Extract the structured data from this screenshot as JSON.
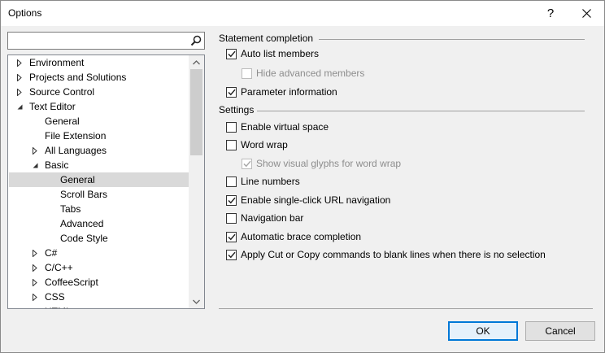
{
  "window": {
    "title": "Options",
    "help_glyph": "?",
    "close_glyph": "✕"
  },
  "search": {
    "value": "",
    "placeholder": ""
  },
  "tree": {
    "items": [
      {
        "label": "Environment",
        "expander": "collapsed"
      },
      {
        "label": "Projects and Solutions",
        "expander": "collapsed"
      },
      {
        "label": "Source Control",
        "expander": "collapsed"
      },
      {
        "label": "Text Editor",
        "expander": "expanded"
      },
      {
        "label": "General",
        "expander": "none"
      },
      {
        "label": "File Extension",
        "expander": "none"
      },
      {
        "label": "All Languages",
        "expander": "collapsed"
      },
      {
        "label": "Basic",
        "expander": "expanded"
      },
      {
        "label": "General",
        "expander": "none",
        "selected": true
      },
      {
        "label": "Scroll Bars",
        "expander": "none"
      },
      {
        "label": "Tabs",
        "expander": "none"
      },
      {
        "label": "Advanced",
        "expander": "none"
      },
      {
        "label": "Code Style",
        "expander": "none"
      },
      {
        "label": "C#",
        "expander": "collapsed"
      },
      {
        "label": "C/C++",
        "expander": "collapsed"
      },
      {
        "label": "CoffeeScript",
        "expander": "collapsed"
      },
      {
        "label": "CSS",
        "expander": "collapsed"
      },
      {
        "label": "HTML",
        "expander": "collapsed"
      }
    ]
  },
  "groups": {
    "statement_completion": {
      "header": "Statement completion",
      "options": [
        {
          "label": "Auto list members",
          "checked": true,
          "enabled": true
        },
        {
          "label": "Hide advanced members",
          "checked": false,
          "enabled": false
        },
        {
          "label": "Parameter information",
          "checked": true,
          "enabled": true
        }
      ]
    },
    "settings": {
      "header": "Settings",
      "options": [
        {
          "label": "Enable virtual space",
          "checked": false,
          "enabled": true
        },
        {
          "label": "Word wrap",
          "checked": false,
          "enabled": true
        },
        {
          "label": "Show visual glyphs for word wrap",
          "checked": true,
          "enabled": false
        },
        {
          "label": "Line numbers",
          "checked": false,
          "enabled": true
        },
        {
          "label": "Enable single-click URL navigation",
          "checked": true,
          "enabled": true
        },
        {
          "label": "Navigation bar",
          "checked": false,
          "enabled": true
        },
        {
          "label": "Automatic brace completion",
          "checked": true,
          "enabled": true
        },
        {
          "label": "Apply Cut or Copy commands to blank lines when there is no selection",
          "checked": true,
          "enabled": true
        }
      ]
    }
  },
  "buttons": {
    "ok": "OK",
    "cancel": "Cancel"
  },
  "colors": {
    "accent": "#0078d7",
    "selection": "#cce8ff",
    "selection_inactive": "#d9d9d9"
  }
}
